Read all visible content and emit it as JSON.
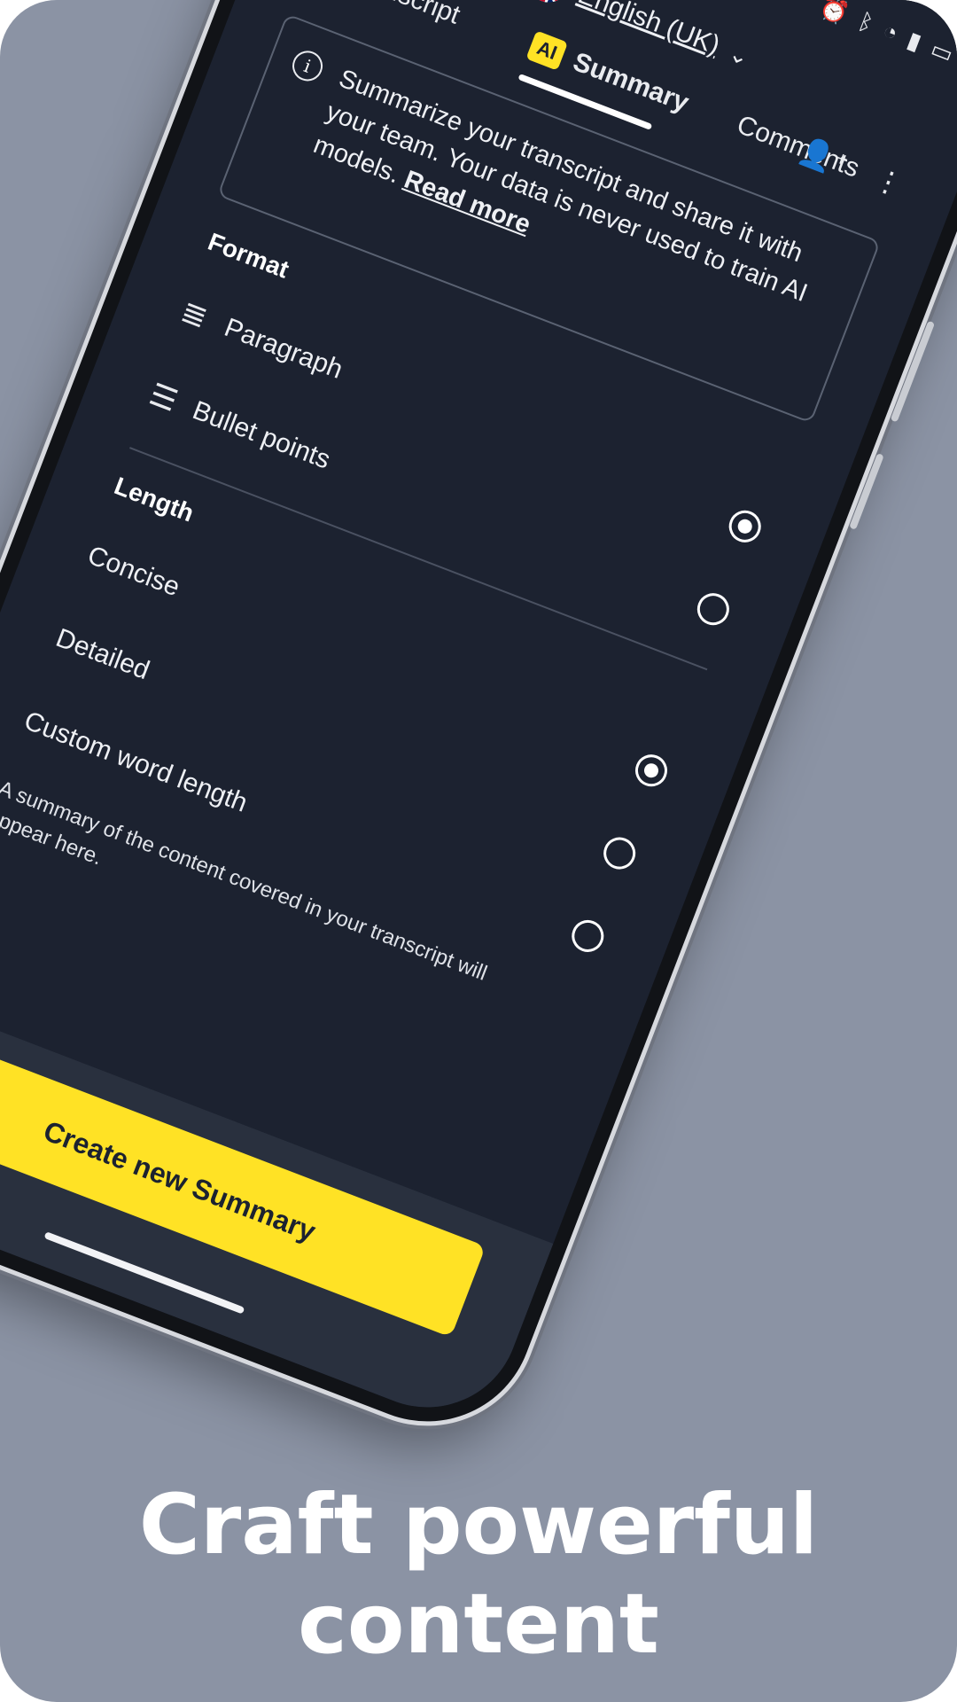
{
  "screen": {
    "back_icon": "chevron-left-icon",
    "status_icons": [
      "alarm-icon",
      "bluetooth-icon",
      "wifi-icon",
      "signal-icon",
      "battery-icon"
    ],
    "language": {
      "flag": "uk-flag-icon",
      "label": "English (UK)",
      "chevron": "chevron-down-icon"
    },
    "tabs": {
      "transcript": "Transcript",
      "summary_badge": "AI",
      "summary": "Summary",
      "comments": "Comments"
    },
    "actions": [
      "add-person-icon",
      "more-vert-icon"
    ],
    "info": {
      "text": "Summarize your transcript and share it with your team. Your data is never used to train AI models.",
      "link": "Read more"
    },
    "format": {
      "title": "Format",
      "options": [
        {
          "label": "Paragraph",
          "icon": "paragraph-icon",
          "selected": true
        },
        {
          "label": "Bullet points",
          "icon": "bullet-list-icon",
          "selected": false
        }
      ]
    },
    "length": {
      "title": "Length",
      "options": [
        {
          "label": "Concise",
          "selected": true
        },
        {
          "label": "Detailed",
          "selected": false
        },
        {
          "label": "Custom word length",
          "selected": false
        }
      ],
      "description": "A summary of the content covered in your transcript will appear here."
    },
    "cta": "Create new Summary"
  },
  "caption": {
    "line1": "Craft powerful",
    "line2": "content"
  },
  "colors": {
    "background": "#8b93a4",
    "screen": "#1c2230",
    "accent": "#ffe225"
  }
}
